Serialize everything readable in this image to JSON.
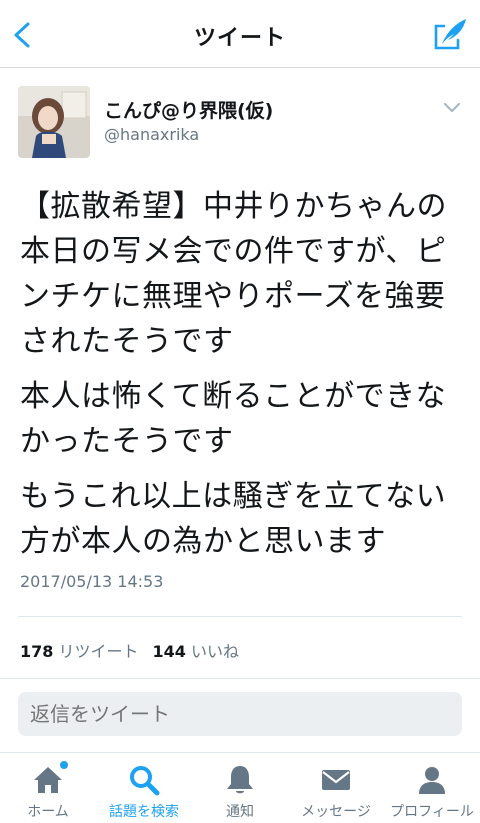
{
  "header": {
    "title": "ツイート"
  },
  "tweet": {
    "display_name": "こんぴ@り界隈(仮)",
    "handle": "@hanaxrika",
    "paragraphs": [
      "【拡散希望】中井りかちゃんの本日の写メ会での件ですが、ピンチケに無理やりポーズを強要されたそうです",
      "本人は怖くて断ることができなかったそうです",
      "もうこれ以上は騒ぎを立てない方が本人の為かと思います"
    ],
    "timestamp": "2017/05/13 14:53",
    "retweet_count": "178",
    "retweet_label": "リツイート",
    "like_count": "144",
    "like_label": "いいね"
  },
  "reply": {
    "placeholder": "返信をツイート"
  },
  "tabbar": {
    "items": [
      {
        "label": "ホーム",
        "icon": "home-icon"
      },
      {
        "label": "話題を検索",
        "icon": "search-icon"
      },
      {
        "label": "通知",
        "icon": "bell-icon"
      },
      {
        "label": "メッセージ",
        "icon": "envelope-icon"
      },
      {
        "label": "プロフィール",
        "icon": "person-icon"
      }
    ]
  },
  "colors": {
    "accent": "#1da1f2",
    "muted": "#657786",
    "text": "#14171a"
  }
}
